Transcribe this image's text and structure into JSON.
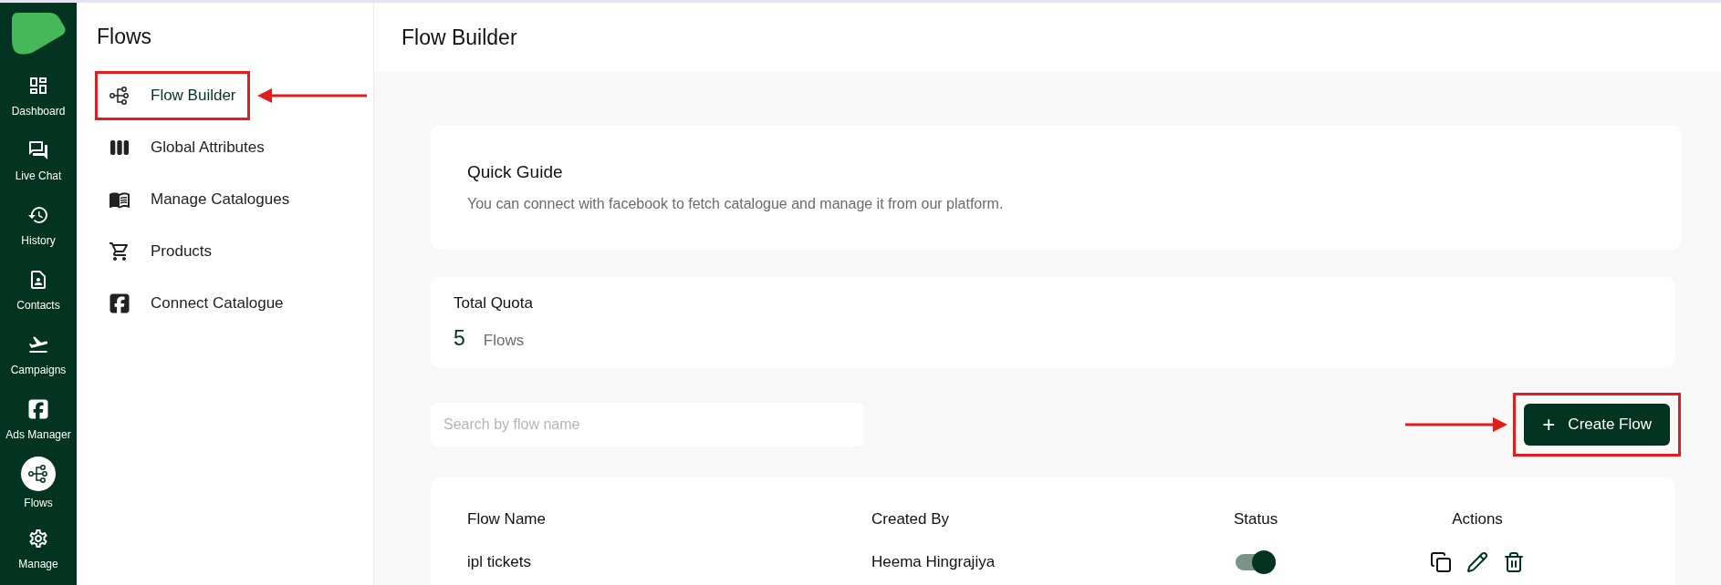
{
  "nav": [
    {
      "label": "Dashboard",
      "kind": "dashboard",
      "selected": false
    },
    {
      "label": "Live Chat",
      "kind": "chat",
      "selected": false
    },
    {
      "label": "History",
      "kind": "history",
      "selected": false
    },
    {
      "label": "Contacts",
      "kind": "contacts",
      "selected": false
    },
    {
      "label": "Campaigns",
      "kind": "takeoff",
      "selected": false
    },
    {
      "label": "Ads Manager",
      "kind": "facebook",
      "selected": false
    },
    {
      "label": "Flows",
      "kind": "flow",
      "selected": true
    },
    {
      "label": "Manage",
      "kind": "gear",
      "selected": false
    }
  ],
  "sidebar": {
    "title": "Flows",
    "items": [
      {
        "label": "Flow Builder",
        "kind": "flow",
        "selected": true,
        "highlighted": true
      },
      {
        "label": "Global Attributes",
        "kind": "columns",
        "selected": false,
        "highlighted": false
      },
      {
        "label": "Manage Catalogues",
        "kind": "book",
        "selected": false,
        "highlighted": false
      },
      {
        "label": "Products",
        "kind": "cart",
        "selected": false,
        "highlighted": false
      },
      {
        "label": "Connect Catalogue",
        "kind": "facebook",
        "selected": false,
        "highlighted": false
      }
    ]
  },
  "page_title": "Flow Builder",
  "quick_guide": {
    "title": "Quick Guide",
    "text": "You can connect with facebook to fetch catalogue and manage it from our platform."
  },
  "quota": {
    "label": "Total Quota",
    "count": "5",
    "unit": "Flows"
  },
  "search": {
    "placeholder": "Search by flow name"
  },
  "create_button": {
    "icon": "+",
    "label": "Create Flow",
    "highlighted": true
  },
  "table": {
    "columns": [
      "Flow Name",
      "Created By",
      "Status",
      "Actions"
    ],
    "rows": [
      {
        "name": "ipl tickets",
        "created_by": "Heema Hingrajiya",
        "on": true
      }
    ]
  }
}
